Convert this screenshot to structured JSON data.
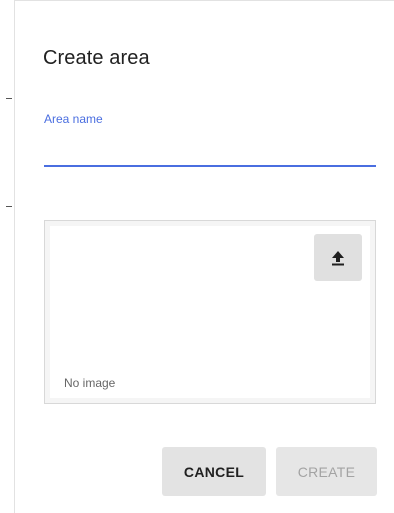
{
  "dialog": {
    "title": "Create area",
    "area_name_label": "Area name",
    "area_name_value": "",
    "image": {
      "empty_text": "No image",
      "upload_icon": "upload-icon"
    },
    "actions": {
      "cancel_label": "CANCEL",
      "create_label": "CREATE"
    }
  },
  "colors": {
    "accent": "#4a6ee0",
    "title_text": "#212121",
    "button_bg": "#e3e3e3",
    "disabled_text": "#a3a3a3"
  }
}
